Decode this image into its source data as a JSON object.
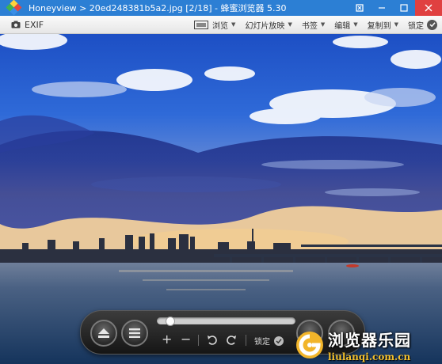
{
  "window": {
    "title": "Honeyview > 20ed248381b5a2.jpg [2/18] - 蜂蜜浏览器 5.30",
    "controls": [
      "pin-icon",
      "minimize-icon",
      "maximize-icon",
      "close-icon"
    ]
  },
  "toolbar": {
    "exif_label": "EXIF",
    "menus": [
      {
        "label": "浏览",
        "icon": "fullscreen-icon"
      },
      {
        "label": "幻灯片放映"
      },
      {
        "label": "书签"
      },
      {
        "label": "编辑"
      },
      {
        "label": "复制到"
      }
    ],
    "lock_label": "锁定"
  },
  "panel": {
    "slider_fraction": 0.04,
    "zoom_in": "+",
    "zoom_out": "−",
    "lock_label": "锁定"
  },
  "watermark": {
    "name": "浏览器乐园",
    "url": "liulanqi.com.cn"
  },
  "colors": {
    "titlebar": "#2c7fd4",
    "close": "#e04040",
    "watermark_url": "#f4c02c"
  }
}
